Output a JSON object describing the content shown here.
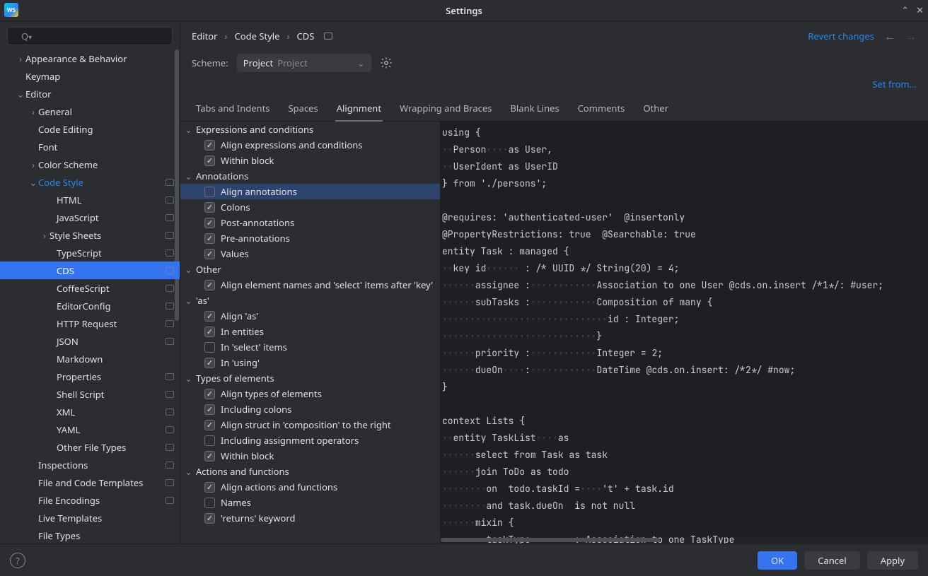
{
  "window": {
    "title": "Settings"
  },
  "search": {
    "placeholder": "",
    "icon_prefix": "Q"
  },
  "sidebar": [
    {
      "label": "Appearance & Behavior",
      "indent": 1,
      "arrow": "right",
      "marker": false
    },
    {
      "label": "Keymap",
      "indent": 1,
      "arrow": "",
      "marker": false
    },
    {
      "label": "Editor",
      "indent": 1,
      "arrow": "down",
      "marker": false
    },
    {
      "label": "General",
      "indent": 2,
      "arrow": "right",
      "marker": false
    },
    {
      "label": "Code Editing",
      "indent": 2,
      "arrow": "",
      "marker": false
    },
    {
      "label": "Font",
      "indent": 2,
      "arrow": "",
      "marker": false
    },
    {
      "label": "Color Scheme",
      "indent": 2,
      "arrow": "right",
      "marker": false
    },
    {
      "label": "Code Style",
      "indent": 2,
      "arrow": "down",
      "marker": true,
      "activePath": true
    },
    {
      "label": "HTML",
      "indent": 4,
      "arrow": "",
      "marker": true
    },
    {
      "label": "JavaScript",
      "indent": 4,
      "arrow": "",
      "marker": true
    },
    {
      "label": "Style Sheets",
      "indent": 3,
      "arrow": "right",
      "marker": true
    },
    {
      "label": "TypeScript",
      "indent": 4,
      "arrow": "",
      "marker": true
    },
    {
      "label": "CDS",
      "indent": 4,
      "arrow": "",
      "marker": true,
      "selected": true
    },
    {
      "label": "CoffeeScript",
      "indent": 4,
      "arrow": "",
      "marker": true
    },
    {
      "label": "EditorConfig",
      "indent": 4,
      "arrow": "",
      "marker": true
    },
    {
      "label": "HTTP Request",
      "indent": 4,
      "arrow": "",
      "marker": true
    },
    {
      "label": "JSON",
      "indent": 4,
      "arrow": "",
      "marker": true
    },
    {
      "label": "Markdown",
      "indent": 4,
      "arrow": "",
      "marker": false
    },
    {
      "label": "Properties",
      "indent": 4,
      "arrow": "",
      "marker": true
    },
    {
      "label": "Shell Script",
      "indent": 4,
      "arrow": "",
      "marker": true
    },
    {
      "label": "XML",
      "indent": 4,
      "arrow": "",
      "marker": true
    },
    {
      "label": "YAML",
      "indent": 4,
      "arrow": "",
      "marker": true
    },
    {
      "label": "Other File Types",
      "indent": 4,
      "arrow": "",
      "marker": true
    },
    {
      "label": "Inspections",
      "indent": 2,
      "arrow": "",
      "marker": true
    },
    {
      "label": "File and Code Templates",
      "indent": 2,
      "arrow": "",
      "marker": true
    },
    {
      "label": "File Encodings",
      "indent": 2,
      "arrow": "",
      "marker": true
    },
    {
      "label": "Live Templates",
      "indent": 2,
      "arrow": "",
      "marker": false
    },
    {
      "label": "File Types",
      "indent": 2,
      "arrow": "",
      "marker": false
    }
  ],
  "breadcrumb": [
    "Editor",
    "Code Style",
    "CDS"
  ],
  "revert": "Revert changes",
  "scheme": {
    "label": "Scheme:",
    "value": "Project",
    "hint": "Project"
  },
  "set_from": "Set from...",
  "tabs": [
    "Tabs and Indents",
    "Spaces",
    "Alignment",
    "Wrapping and Braces",
    "Blank Lines",
    "Comments",
    "Other"
  ],
  "active_tab": 2,
  "groups": [
    {
      "title": "Expressions and conditions",
      "items": [
        {
          "label": "Align expressions and conditions",
          "checked": true
        },
        {
          "label": "Within block",
          "checked": true
        }
      ]
    },
    {
      "title": "Annotations",
      "items": [
        {
          "label": "Align annotations",
          "checked": false,
          "selected": true
        },
        {
          "label": "Colons",
          "checked": true
        },
        {
          "label": "Post-annotations",
          "checked": true
        },
        {
          "label": "Pre-annotations",
          "checked": true
        },
        {
          "label": "Values",
          "checked": true
        }
      ]
    },
    {
      "title": "Other",
      "items": [
        {
          "label": "Align element names and 'select' items after 'key'",
          "checked": true
        }
      ]
    },
    {
      "title": "'as'",
      "items": [
        {
          "label": "Align 'as'",
          "checked": true
        },
        {
          "label": "In entities",
          "checked": true
        },
        {
          "label": "In 'select' items",
          "checked": false
        },
        {
          "label": "In 'using'",
          "checked": true
        }
      ]
    },
    {
      "title": "Types of elements",
      "items": [
        {
          "label": "Align types of elements",
          "checked": true
        },
        {
          "label": "Including colons",
          "checked": true
        },
        {
          "label": "Align struct in 'composition' to the right",
          "checked": true
        },
        {
          "label": "Including assignment operators",
          "checked": false
        },
        {
          "label": "Within block",
          "checked": true
        }
      ]
    },
    {
      "title": "Actions and functions",
      "items": [
        {
          "label": "Align actions and functions",
          "checked": true
        },
        {
          "label": "Names",
          "checked": false
        },
        {
          "label": "'returns' keyword",
          "checked": true
        }
      ]
    }
  ],
  "preview_lines": [
    {
      "t": "using {"
    },
    {
      "ws": "··",
      "t": "Person",
      "ws2": "····",
      "t2": "as User,"
    },
    {
      "ws": "··",
      "t": "UserIdent as UserID"
    },
    {
      "t": "} from './persons';"
    },
    {
      "t": ""
    },
    {
      "t": "@requires: 'authenticated-user'  @insertonly"
    },
    {
      "t": "@PropertyRestrictions: true  @Searchable: true"
    },
    {
      "t": "entity Task : managed {"
    },
    {
      "ws": "··",
      "t": "key id",
      "ws2": "······",
      "t2": " : /* UUID */ String(20) = 4;"
    },
    {
      "ws": "······",
      "t": "assignee :",
      "ws2": "············",
      "t2": "Association to one User @cds.on.insert /*1*/: #user;"
    },
    {
      "ws": "······",
      "t": "subTasks :",
      "ws2": "············",
      "t2": "Composition of many {"
    },
    {
      "ws": "······························",
      "t": "id : Integer;"
    },
    {
      "ws": "····························",
      "t": "}"
    },
    {
      "ws": "······",
      "t": "priority :",
      "ws2": "············",
      "t2": "Integer = 2;"
    },
    {
      "ws": "······",
      "t": "dueOn",
      "ws2": "····",
      "t2": ":",
      "ws3": "············",
      "t3": "DateTime @cds.on.insert: /*2*/ #now;"
    },
    {
      "t": "}"
    },
    {
      "t": ""
    },
    {
      "t": "context Lists {"
    },
    {
      "ws": "··",
      "t": "entity TaskList",
      "ws2": "····",
      "t2": "as"
    },
    {
      "ws": "······",
      "t": "select from Task as task"
    },
    {
      "ws": "······",
      "t": "join ToDo as todo"
    },
    {
      "ws": "········",
      "t": "on  todo.taskId =",
      "ws2": "····",
      "t2": "'t' + task.id"
    },
    {
      "ws": "········",
      "t": "and task.dueOn  is not null"
    },
    {
      "ws": "······",
      "t": "mixin {"
    },
    {
      "ws": "········",
      "t": "taskType",
      "ws2": "········",
      "t2": ": Association to one TaskType"
    }
  ],
  "footer": {
    "ok": "OK",
    "cancel": "Cancel",
    "apply": "Apply"
  }
}
